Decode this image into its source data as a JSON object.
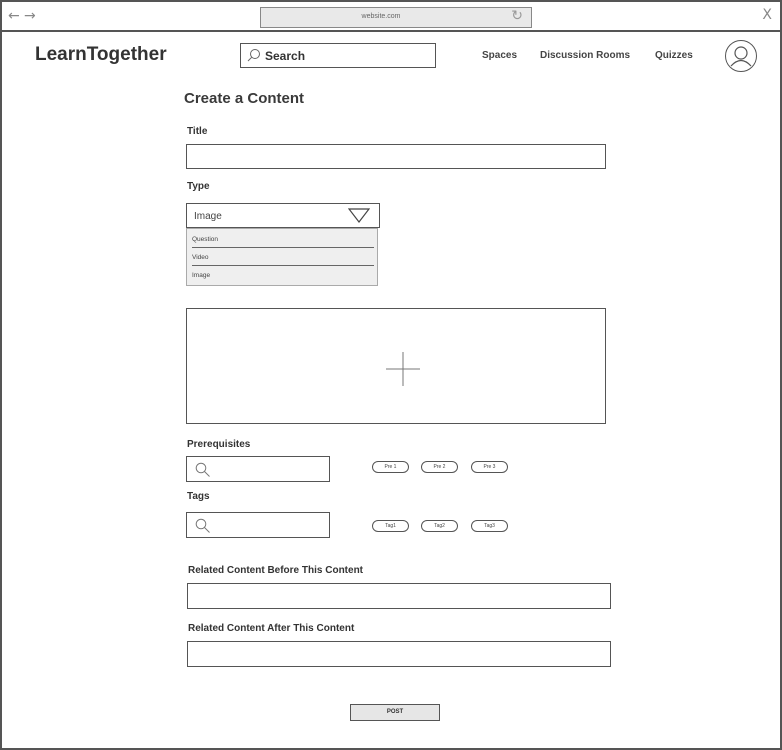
{
  "browser": {
    "back_icon": "←",
    "forward_icon": "→",
    "url": "website.com",
    "reload_icon": "↻",
    "close_icon": "X"
  },
  "header": {
    "logo": "LearnTogether",
    "search_label": "Search",
    "nav": [
      "Spaces",
      "Discussion Rooms",
      "Quizzes"
    ]
  },
  "page": {
    "title": "Create a Content"
  },
  "form": {
    "title_label": "Title",
    "title_value": "",
    "type_label": "Type",
    "type_selected": "Image",
    "type_options": [
      "Question",
      "Video",
      "Image"
    ],
    "prerequisites_label": "Prerequisites",
    "prerequisites_chips": [
      "Pre 1",
      "Pre 2",
      "Pre 3"
    ],
    "tags_label": "Tags",
    "tags_chips": [
      "Tag1",
      "Tag2",
      "Tag3"
    ],
    "related_before_label": "Related Content Before This Content",
    "related_after_label": "Related Content After This Content",
    "post_label": "POST"
  }
}
